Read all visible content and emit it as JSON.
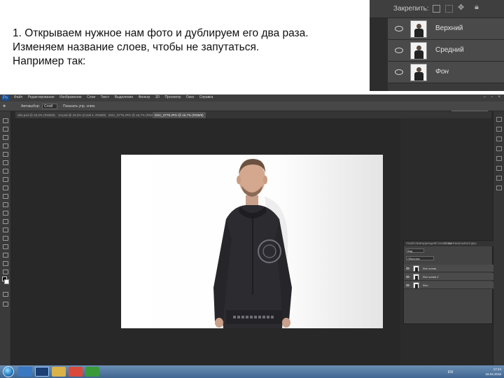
{
  "slide": {
    "caption_lines": [
      "1. Открываем нужное нам фото и дублируем его два раза.",
      "Изменяем название слоев, чтобы не запутаться.",
      "Например так:"
    ]
  },
  "layers_inset": {
    "lock_label": "Закрепить:",
    "layers": [
      {
        "name": "Верхний",
        "italic": false
      },
      {
        "name": "Средний",
        "italic": false
      },
      {
        "name": "Фон",
        "italic": true
      }
    ]
  },
  "photoshop": {
    "logo": "Ps",
    "menu": [
      "Файл",
      "Редактирование",
      "Изображение",
      "Слои",
      "Текст",
      "Выделение",
      "Фильтр",
      "3D",
      "Просмотр",
      "Окно",
      "Справка"
    ],
    "options": {
      "autoselect_label": "Автовыбор:",
      "autoselect_value": "Слой",
      "show_controls": "Показать упр. элем."
    },
    "tabs": [
      {
        "label": "afto.psd @ 33,3% (RGB/8)",
        "active": false
      },
      {
        "label": "13.psd @ 33,3% (Слой 1, RGB/8)",
        "active": false
      },
      {
        "label": "DSC_0779.JPG @ 16,7% (RGB/8)",
        "active": false
      },
      {
        "label": "DSC_0779.JPG @ 16,7% (RGB/8)",
        "active": true
      }
    ],
    "workspace": "Основная рабочая среда",
    "status": {
      "zoom": "16,67%",
      "doc": "Док: 16,7M/26,0M"
    },
    "layers_panel": {
      "tabs": [
        "Свойства",
        "Коррекция",
        "Стили",
        "Слои",
        "Каналы",
        "Контуры"
      ],
      "active_tab": "Слои",
      "kind": "Вид",
      "blend_mode": "Обычные",
      "layers": [
        {
          "name": "Фон копия",
          "selected": false
        },
        {
          "name": "Фон копия 2",
          "selected": false
        },
        {
          "name": "Фон",
          "selected": false
        }
      ]
    }
  },
  "taskbar": {
    "lang": "EN",
    "time": "17:44",
    "date": "18.04.2016",
    "colors": {
      "start": "#2a80c5",
      "bar": "#3f6690"
    }
  }
}
